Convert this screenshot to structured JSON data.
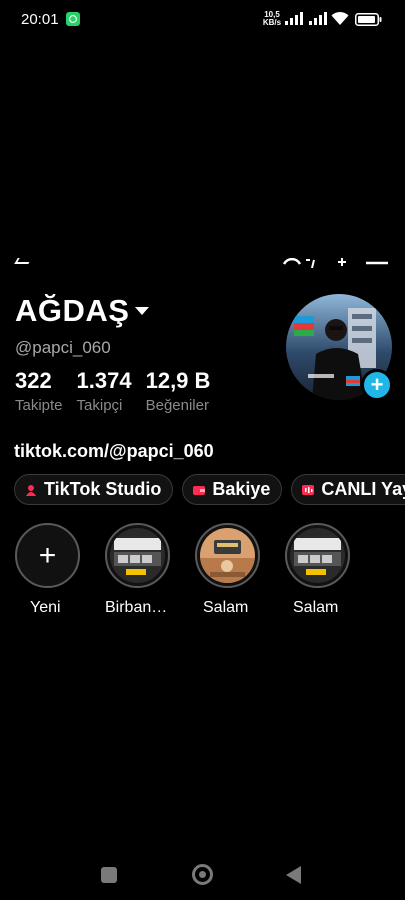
{
  "status_bar": {
    "time": "20:01",
    "net_speed_value": "10,5",
    "net_speed_unit": "KB/s",
    "battery_level_percent": 80
  },
  "profile": {
    "name": "AĞDAŞ",
    "handle": "@papci_060",
    "stats": [
      {
        "value": "322",
        "label": "Takipte"
      },
      {
        "value": "1.374",
        "label": "Takipçi"
      },
      {
        "value": "12,9 B",
        "label": "Beğeniler"
      }
    ],
    "add_button": "+",
    "bio_link": "tiktok.com/@papci_060"
  },
  "chips": [
    {
      "label": "TikTok Studio",
      "icon": "tiktok-studio-icon",
      "color": "#fe2c55"
    },
    {
      "label": "Bakiye",
      "icon": "wallet-icon",
      "color": "#fe2c55"
    },
    {
      "label": "CANLI Yay",
      "icon": "live-icon",
      "color": "#fe2c55"
    }
  ],
  "highlights": [
    {
      "label": "Yeni",
      "icon": "+"
    },
    {
      "label": "Birban…"
    },
    {
      "label": "Salam"
    },
    {
      "label": "Salam"
    }
  ],
  "colors": {
    "accent_blue": "#20b6e8",
    "tiktok_red": "#fe2c55",
    "background": "#000000"
  }
}
